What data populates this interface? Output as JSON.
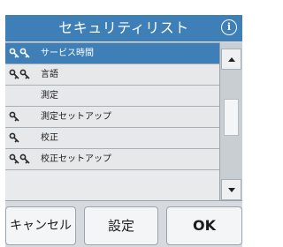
{
  "title_bar": {
    "title": "セキュリティリスト",
    "info_icon": "info-icon"
  },
  "list": {
    "items": [
      {
        "label": "サービス時間",
        "selected": true,
        "icon": "double-key-icon"
      },
      {
        "label": "言語",
        "selected": false,
        "icon": "double-key-icon"
      },
      {
        "label": "測定",
        "selected": false,
        "icon": ""
      },
      {
        "label": "測定セットアップ",
        "selected": false,
        "icon": "single-key-icon"
      },
      {
        "label": "校正",
        "selected": false,
        "icon": "single-key-icon"
      },
      {
        "label": "校正セットアップ",
        "selected": false,
        "icon": "double-key-icon"
      }
    ]
  },
  "scrollbar": {
    "up_icon": "arrow-up-icon",
    "down_icon": "arrow-down-icon"
  },
  "footer": {
    "cancel_label": "キャンセル",
    "settings_label": "設定",
    "ok_label": "OK"
  },
  "colors": {
    "accent": "#3f7fb8",
    "background": "#dfe3e7"
  }
}
